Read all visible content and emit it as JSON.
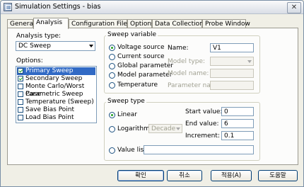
{
  "window": {
    "title": "Simulation Settings - bias",
    "close_glyph": "✕",
    "icon": "app-icon"
  },
  "tabs": [
    "General",
    "Analysis",
    "Configuration Files",
    "Options",
    "Data Collection",
    "Probe Window"
  ],
  "analysis": {
    "type_label": "Analysis type:",
    "type_value": "DC Sweep",
    "options_label": "Options:",
    "options": [
      {
        "label": "Primary Sweep",
        "checked": true,
        "selected": true
      },
      {
        "label": "Secondary Sweep",
        "checked": true,
        "selected": false
      },
      {
        "label": "Monte Carlo/Worst Case",
        "checked": false,
        "selected": false
      },
      {
        "label": "Parametric Sweep",
        "checked": false,
        "selected": false
      },
      {
        "label": "Temperature (Sweep)",
        "checked": false,
        "selected": false
      },
      {
        "label": "Save Bias Point",
        "checked": false,
        "selected": false
      },
      {
        "label": "Load Bias Point",
        "checked": false,
        "selected": false
      }
    ]
  },
  "sweep_variable": {
    "title": "Sweep variable",
    "radios": [
      "Voltage source",
      "Current source",
      "Global parameter",
      "Model parameter",
      "Temperature"
    ],
    "selected": "Voltage source",
    "name_label": "Name:",
    "name_value": "V1",
    "model_type_label": "Model type:",
    "model_name_label": "Model name:",
    "parameter_name_label": "Parameter name:"
  },
  "sweep_type": {
    "title": "Sweep type",
    "linear_label": "Linear",
    "log_label": "Logarithmic",
    "log_scale_value": "Decade",
    "value_list_label": "Value list",
    "start_label": "Start value:",
    "start_value": "0",
    "end_label": "End value:",
    "end_value": "6",
    "increment_label": "Increment:",
    "increment_value": "0.1"
  },
  "buttons": {
    "ok": "확인",
    "cancel": "취소",
    "apply": "적용(A)",
    "help": "도움말"
  }
}
